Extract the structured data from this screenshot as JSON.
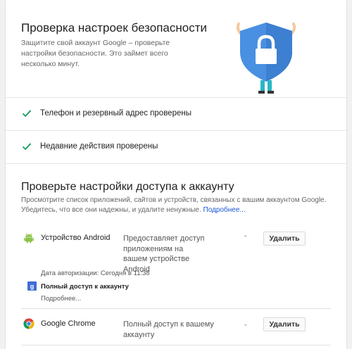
{
  "hero": {
    "title": "Проверка настроек безопасности",
    "description": "Защитите свой аккаунт Google – проверьте настройки безопасности. Это займет всего несколько минут.",
    "colors": {
      "shield": "#4a90e2",
      "pants": "#29b6c6"
    }
  },
  "checks": [
    {
      "label": "Телефон и резервный адрес проверены",
      "icon": "check-icon"
    },
    {
      "label": "Недавние действия проверены",
      "icon": "check-icon"
    }
  ],
  "access": {
    "title": "Проверьте настройки доступа к аккаунту",
    "description": "Просмотрите список приложений, сайтов и устройств, связанных с вашим аккаунтом Google. Убедитесь, что все они надежны, и удалите ненужные.",
    "more_link": "Подробнее...",
    "apps": [
      {
        "name": "Устройство Android",
        "icon": "android-icon",
        "description": "Предоставляет доступ приложениям на вашем устройстве Android",
        "remove_label": "Удалить",
        "expanded": true,
        "auth_date": "Дата авторизации: Сегодня в 11:38",
        "permission": "Полный доступ к аккаунту",
        "permission_icon": "google-plus-icon",
        "more_link": "Подробнее..."
      },
      {
        "name": "Google Chrome",
        "icon": "chrome-icon",
        "description": "Полный доступ к вашему аккаунту",
        "remove_label": "Удалить",
        "expanded": false
      }
    ]
  },
  "colors": {
    "check": "#0f9d58",
    "link": "#1a56d6",
    "android": "#8bc34a",
    "google_plus": "#3f6ed8"
  }
}
